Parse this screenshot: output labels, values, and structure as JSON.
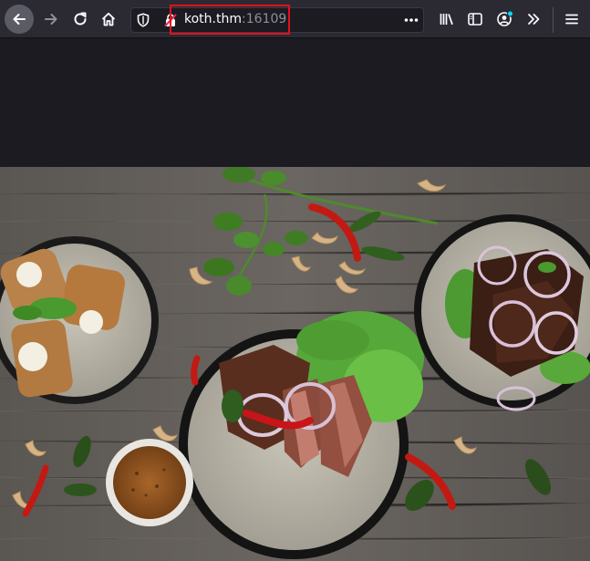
{
  "browser": {
    "toolbar_icons": [
      "back-arrow-icon",
      "forward-arrow-icon",
      "reload-icon",
      "home-icon",
      "shield-icon",
      "insecure-lock-icon",
      "page-actions-icon",
      "library-icon",
      "sidebar-icon",
      "account-icon",
      "overflow-chevron-icon",
      "menu-icon"
    ],
    "url": {
      "host": "koth.thm",
      "port": ":16109"
    },
    "colors": {
      "toolbar": "#2b2a33",
      "page_background": "#1c1b22",
      "url_highlight_border": "#e0101c",
      "account_badge": "#00ddff"
    }
  },
  "page": {
    "hero_image": "food-photo-dishes-on-wooden-table"
  }
}
